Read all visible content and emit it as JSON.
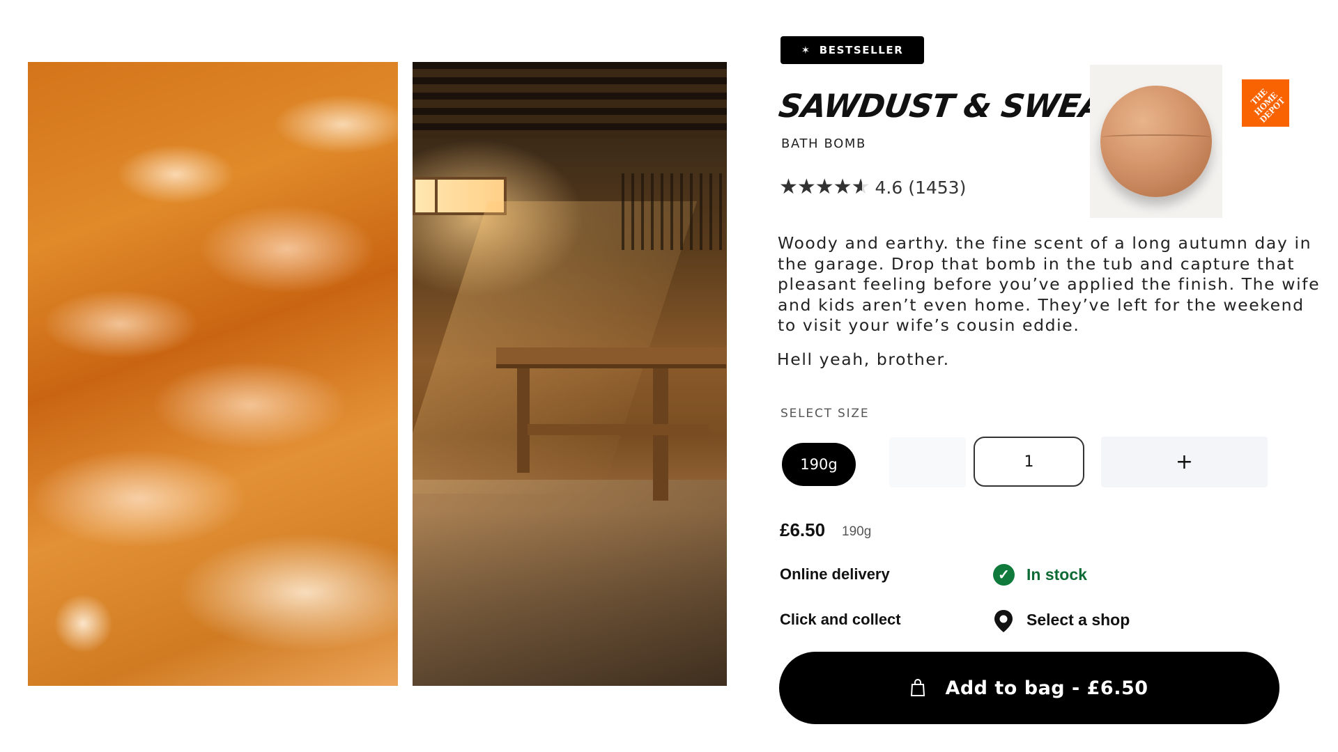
{
  "badge": {
    "label": "BESTSELLER",
    "icon": "sparkle-icon"
  },
  "product": {
    "name": "SAWDUST & SWEAT",
    "type": "BATH BOMB",
    "rating": 4.6,
    "rating_text": "4.6 (1453)",
    "description": "Woody and earthy. the fine scent of a long autumn day in the garage. Drop that bomb in the tub and capture that pleasant feeling before you’ve applied the finish. The wife and kids aren’t even home. They’ve left for the weekend to visit your wife’s cousin eddie.",
    "tagline": "Hell yeah, brother.",
    "thumbnail": "bath-bomb-photo",
    "brand_logo": {
      "text": "THE HOME DEPOT",
      "color": "#f96302"
    }
  },
  "gallery": [
    {
      "name": "orange-foam-photo"
    },
    {
      "name": "garage-workbench-photo"
    }
  ],
  "size": {
    "label": "SELECT SIZE",
    "selected": "190g"
  },
  "quantity": {
    "value": "1",
    "increment_label": "+"
  },
  "price": {
    "amount": "£6.50",
    "size": "190g"
  },
  "delivery": {
    "online_label": "Online delivery",
    "online_status": "In stock",
    "collect_label": "Click and collect",
    "collect_action": "Select a shop"
  },
  "cta": {
    "label": "Add to bag - £6.50",
    "icon": "shopping-bag-icon"
  },
  "colors": {
    "accent": "#000000",
    "in_stock": "#0f7a3c",
    "brand_orange": "#f96302"
  }
}
